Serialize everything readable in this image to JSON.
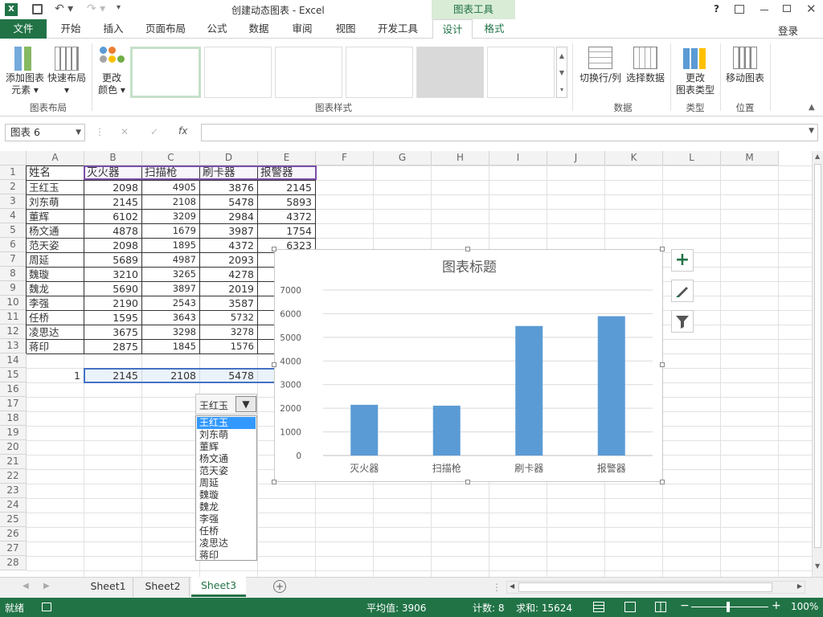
{
  "title": {
    "doc": "创建动态图表 - Excel",
    "tools": "图表工具",
    "help": "?",
    "signin": "登录"
  },
  "tabs": [
    "文件",
    "开始",
    "插入",
    "页面布局",
    "公式",
    "数据",
    "审阅",
    "视图",
    "开发工具",
    "设计",
    "格式"
  ],
  "ribbon": {
    "add_element": "添加图表\n元素 ▾",
    "quick_layout": "快速布局\n▾",
    "change_color": "更改\n颜色 ▾",
    "switch_rowcol": "切换行/列",
    "select_data": "选择数据",
    "change_type": "更改\n图表类型",
    "move_chart": "移动图表",
    "groups": {
      "layout": "图表布局",
      "styles": "图表样式",
      "data": "数据",
      "type": "类型",
      "location": "位置"
    }
  },
  "formula": {
    "namebox": "图表 6",
    "fx": "fx",
    "cancel": "✕",
    "enter": "✓"
  },
  "columns": [
    "A",
    "B",
    "C",
    "D",
    "E",
    "F",
    "G",
    "H",
    "I",
    "J",
    "K",
    "L",
    "M"
  ],
  "rows": [
    "1",
    "2",
    "3",
    "4",
    "5",
    "6",
    "7",
    "8",
    "9",
    "10",
    "11",
    "12",
    "13",
    "14",
    "15",
    "16",
    "17",
    "18",
    "19",
    "20",
    "21",
    "22",
    "23",
    "24",
    "25",
    "26",
    "27",
    "28"
  ],
  "table": {
    "headers": [
      "姓名",
      "灭火器",
      "扫描枪",
      "刷卡器",
      "报警器"
    ],
    "data": [
      [
        "王红玉",
        "2098",
        "4905",
        "3876",
        "2145"
      ],
      [
        "刘东萌",
        "2145",
        "2108",
        "5478",
        "5893"
      ],
      [
        "董辉",
        "6102",
        "3209",
        "2984",
        "4372"
      ],
      [
        "杨文通",
        "4878",
        "1679",
        "3987",
        "1754"
      ],
      [
        "范天姿",
        "2098",
        "1895",
        "4372",
        "6323"
      ],
      [
        "周延",
        "5689",
        "4987",
        "2093",
        ""
      ],
      [
        "魏璇",
        "3210",
        "3265",
        "4278",
        ""
      ],
      [
        "魏龙",
        "5690",
        "3897",
        "2019",
        ""
      ],
      [
        "李强",
        "2190",
        "2543",
        "3587",
        ""
      ],
      [
        "任桥",
        "1595",
        "3643",
        "5732",
        ""
      ],
      [
        "凌思达",
        "3675",
        "3298",
        "3278",
        ""
      ],
      [
        "蒋印",
        "2875",
        "1845",
        "1576",
        ""
      ]
    ],
    "row15": [
      "1",
      "2145",
      "2108",
      "5478"
    ]
  },
  "combo": {
    "selected": "王红玉",
    "options": [
      "王红玉",
      "刘东萌",
      "董辉",
      "杨文通",
      "范天姿",
      "周延",
      "魏璇",
      "魏龙",
      "李强",
      "任桥",
      "凌思达",
      "蒋印"
    ]
  },
  "chart_data": {
    "type": "bar",
    "title": "图表标题",
    "categories": [
      "灭火器",
      "扫描枪",
      "刷卡器",
      "报警器"
    ],
    "values": [
      2145,
      2108,
      5478,
      5893
    ],
    "ylim": [
      0,
      7000
    ],
    "yticks": [
      "0",
      "1000",
      "2000",
      "3000",
      "4000",
      "5000",
      "6000",
      "7000"
    ],
    "color": "#5b9bd5",
    "grid": true
  },
  "sheets": [
    "Sheet1",
    "Sheet2",
    "Sheet3"
  ],
  "status": {
    "ready": "就绪",
    "avg": "平均值: 3906",
    "count": "计数: 8",
    "sum": "求和: 15624",
    "zoom": "100%"
  },
  "colors": {
    "excel_green": "#217346",
    "accent": "#5b9bd5"
  }
}
